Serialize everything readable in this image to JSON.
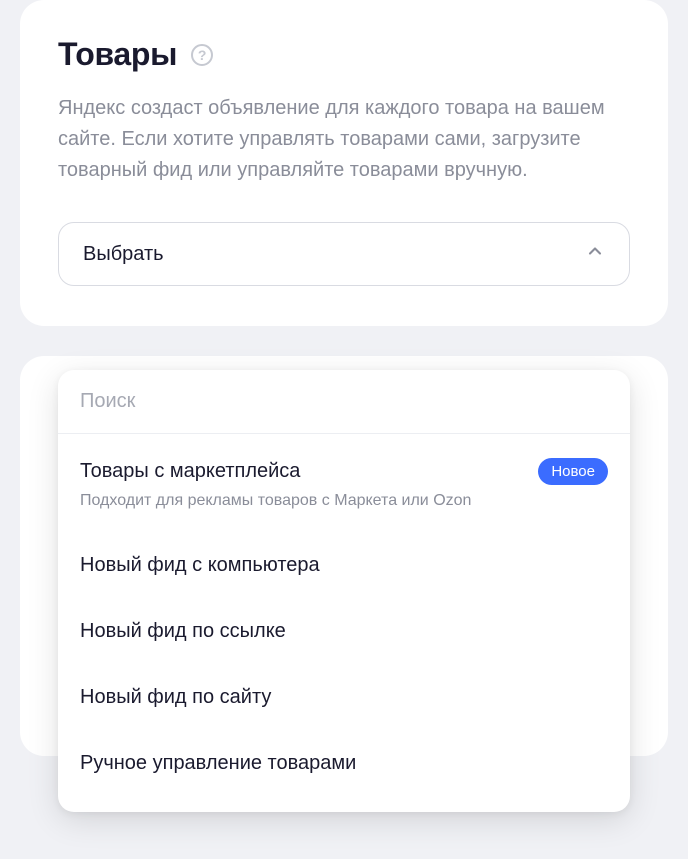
{
  "header": {
    "title": "Товары",
    "help_glyph": "?",
    "description": "Яндекс создаст объявление для каждого товара на вашем сайте. Если хотите управлять товарами сами, загрузите товарный фид или управляйте товарами вручную."
  },
  "select": {
    "value": "Выбрать"
  },
  "dropdown": {
    "search_placeholder": "Поиск",
    "options": [
      {
        "label": "Товары с маркетплейса",
        "sub": "Подходит для рекламы товаров с Маркета или Ozon",
        "badge": "Новое"
      },
      {
        "label": "Новый фид с компьютера"
      },
      {
        "label": "Новый фид по ссылке"
      },
      {
        "label": "Новый фид по сайту"
      },
      {
        "label": "Ручное управление товарами"
      }
    ]
  }
}
